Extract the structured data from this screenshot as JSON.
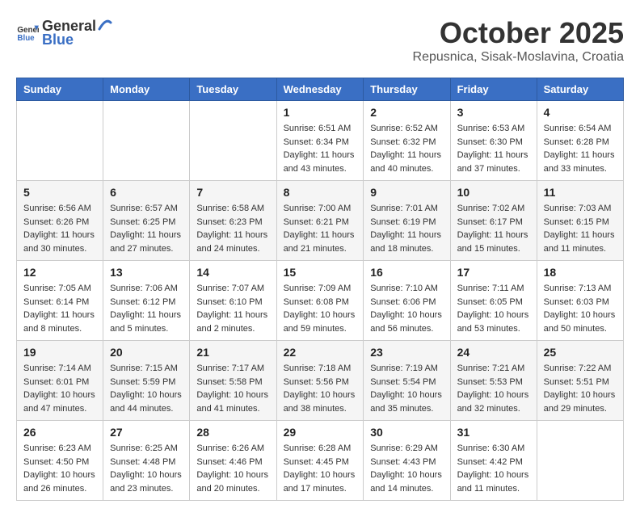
{
  "header": {
    "logo_general": "General",
    "logo_blue": "Blue",
    "month": "October 2025",
    "location": "Repusnica, Sisak-Moslavina, Croatia"
  },
  "days_of_week": [
    "Sunday",
    "Monday",
    "Tuesday",
    "Wednesday",
    "Thursday",
    "Friday",
    "Saturday"
  ],
  "weeks": [
    [
      {
        "day": "",
        "info": ""
      },
      {
        "day": "",
        "info": ""
      },
      {
        "day": "",
        "info": ""
      },
      {
        "day": "1",
        "info": "Sunrise: 6:51 AM\nSunset: 6:34 PM\nDaylight: 11 hours and 43 minutes."
      },
      {
        "day": "2",
        "info": "Sunrise: 6:52 AM\nSunset: 6:32 PM\nDaylight: 11 hours and 40 minutes."
      },
      {
        "day": "3",
        "info": "Sunrise: 6:53 AM\nSunset: 6:30 PM\nDaylight: 11 hours and 37 minutes."
      },
      {
        "day": "4",
        "info": "Sunrise: 6:54 AM\nSunset: 6:28 PM\nDaylight: 11 hours and 33 minutes."
      }
    ],
    [
      {
        "day": "5",
        "info": "Sunrise: 6:56 AM\nSunset: 6:26 PM\nDaylight: 11 hours and 30 minutes."
      },
      {
        "day": "6",
        "info": "Sunrise: 6:57 AM\nSunset: 6:25 PM\nDaylight: 11 hours and 27 minutes."
      },
      {
        "day": "7",
        "info": "Sunrise: 6:58 AM\nSunset: 6:23 PM\nDaylight: 11 hours and 24 minutes."
      },
      {
        "day": "8",
        "info": "Sunrise: 7:00 AM\nSunset: 6:21 PM\nDaylight: 11 hours and 21 minutes."
      },
      {
        "day": "9",
        "info": "Sunrise: 7:01 AM\nSunset: 6:19 PM\nDaylight: 11 hours and 18 minutes."
      },
      {
        "day": "10",
        "info": "Sunrise: 7:02 AM\nSunset: 6:17 PM\nDaylight: 11 hours and 15 minutes."
      },
      {
        "day": "11",
        "info": "Sunrise: 7:03 AM\nSunset: 6:15 PM\nDaylight: 11 hours and 11 minutes."
      }
    ],
    [
      {
        "day": "12",
        "info": "Sunrise: 7:05 AM\nSunset: 6:14 PM\nDaylight: 11 hours and 8 minutes."
      },
      {
        "day": "13",
        "info": "Sunrise: 7:06 AM\nSunset: 6:12 PM\nDaylight: 11 hours and 5 minutes."
      },
      {
        "day": "14",
        "info": "Sunrise: 7:07 AM\nSunset: 6:10 PM\nDaylight: 11 hours and 2 minutes."
      },
      {
        "day": "15",
        "info": "Sunrise: 7:09 AM\nSunset: 6:08 PM\nDaylight: 10 hours and 59 minutes."
      },
      {
        "day": "16",
        "info": "Sunrise: 7:10 AM\nSunset: 6:06 PM\nDaylight: 10 hours and 56 minutes."
      },
      {
        "day": "17",
        "info": "Sunrise: 7:11 AM\nSunset: 6:05 PM\nDaylight: 10 hours and 53 minutes."
      },
      {
        "day": "18",
        "info": "Sunrise: 7:13 AM\nSunset: 6:03 PM\nDaylight: 10 hours and 50 minutes."
      }
    ],
    [
      {
        "day": "19",
        "info": "Sunrise: 7:14 AM\nSunset: 6:01 PM\nDaylight: 10 hours and 47 minutes."
      },
      {
        "day": "20",
        "info": "Sunrise: 7:15 AM\nSunset: 5:59 PM\nDaylight: 10 hours and 44 minutes."
      },
      {
        "day": "21",
        "info": "Sunrise: 7:17 AM\nSunset: 5:58 PM\nDaylight: 10 hours and 41 minutes."
      },
      {
        "day": "22",
        "info": "Sunrise: 7:18 AM\nSunset: 5:56 PM\nDaylight: 10 hours and 38 minutes."
      },
      {
        "day": "23",
        "info": "Sunrise: 7:19 AM\nSunset: 5:54 PM\nDaylight: 10 hours and 35 minutes."
      },
      {
        "day": "24",
        "info": "Sunrise: 7:21 AM\nSunset: 5:53 PM\nDaylight: 10 hours and 32 minutes."
      },
      {
        "day": "25",
        "info": "Sunrise: 7:22 AM\nSunset: 5:51 PM\nDaylight: 10 hours and 29 minutes."
      }
    ],
    [
      {
        "day": "26",
        "info": "Sunrise: 6:23 AM\nSunset: 4:50 PM\nDaylight: 10 hours and 26 minutes."
      },
      {
        "day": "27",
        "info": "Sunrise: 6:25 AM\nSunset: 4:48 PM\nDaylight: 10 hours and 23 minutes."
      },
      {
        "day": "28",
        "info": "Sunrise: 6:26 AM\nSunset: 4:46 PM\nDaylight: 10 hours and 20 minutes."
      },
      {
        "day": "29",
        "info": "Sunrise: 6:28 AM\nSunset: 4:45 PM\nDaylight: 10 hours and 17 minutes."
      },
      {
        "day": "30",
        "info": "Sunrise: 6:29 AM\nSunset: 4:43 PM\nDaylight: 10 hours and 14 minutes."
      },
      {
        "day": "31",
        "info": "Sunrise: 6:30 AM\nSunset: 4:42 PM\nDaylight: 10 hours and 11 minutes."
      },
      {
        "day": "",
        "info": ""
      }
    ]
  ]
}
